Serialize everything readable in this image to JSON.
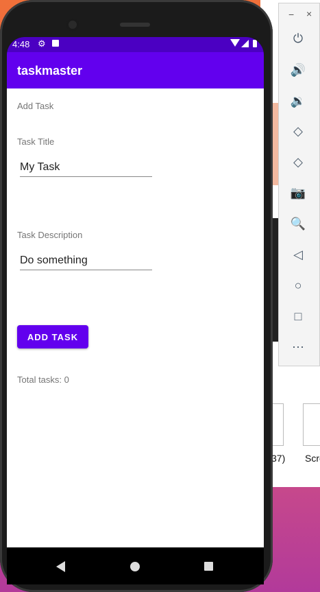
{
  "status_bar": {
    "time": "4:48"
  },
  "app_bar": {
    "title": "taskmaster"
  },
  "form": {
    "heading": "Add Task",
    "title_label": "Task Title",
    "title_value": "My Task",
    "description_label": "Task Description",
    "description_value": "Do something",
    "submit_label": "ADD TASK",
    "total_tasks_text": "Total tasks: 0"
  },
  "nav_bar": {
    "icons": [
      "back-icon",
      "home-icon",
      "recents-icon"
    ]
  },
  "emulator_toolbar": {
    "window_controls": {
      "minimize": "−",
      "close": "×"
    },
    "icons": [
      "power-icon",
      "volume-up-icon",
      "volume-down-icon",
      "rotate-left-icon",
      "rotate-right-icon",
      "camera-icon",
      "zoom-icon",
      "back-icon",
      "home-icon",
      "overview-icon",
      "more-icon"
    ]
  },
  "desktop": {
    "thumb_label_1": "37)",
    "thumb_label_2": "Scre"
  },
  "colors": {
    "primary": "#6200ee",
    "status_bar": "#4b00c2"
  }
}
